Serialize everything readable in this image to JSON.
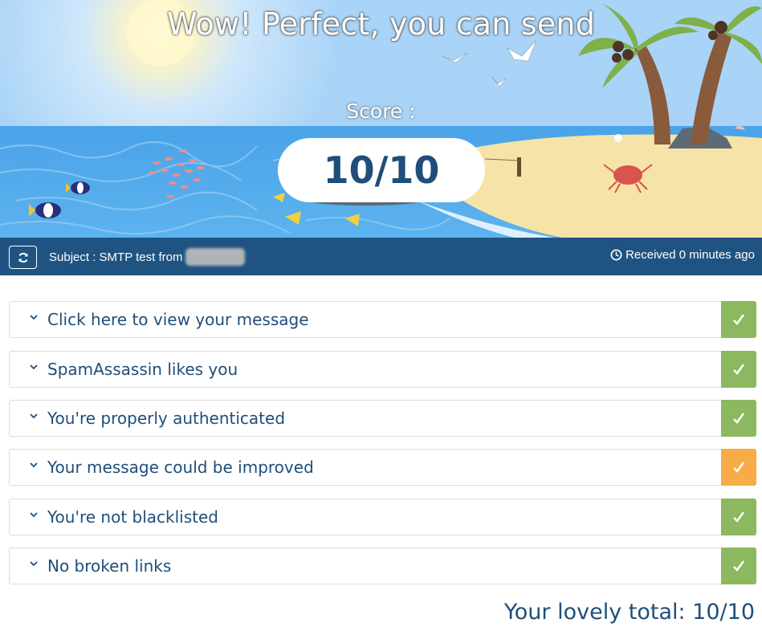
{
  "hero": {
    "title": "Wow! Perfect, you can send",
    "score_label": "Score :",
    "score_value": "10/10"
  },
  "infobar": {
    "refresh_icon": "refresh-icon",
    "subject_text": "Subject : SMTP test from",
    "received_icon": "clock-icon",
    "received_text": "Received 0 minutes ago"
  },
  "checks": [
    {
      "label": "Click here to view your message",
      "status": "ok",
      "icon": "checkmark-icon"
    },
    {
      "label": "SpamAssassin likes you",
      "status": "ok",
      "icon": "checkmark-icon"
    },
    {
      "label": "You're properly authenticated",
      "status": "ok",
      "icon": "checkmark-icon"
    },
    {
      "label": "Your message could be improved",
      "status": "warning",
      "icon": "checkmark-icon"
    },
    {
      "label": "You're not blacklisted",
      "status": "ok",
      "icon": "checkmark-icon"
    },
    {
      "label": "No broken links",
      "status": "ok",
      "icon": "checkmark-icon"
    }
  ],
  "total": "Your lovely total: 10/10",
  "colors": {
    "ok": "#8cb860",
    "warning": "#f7ac47",
    "bar": "#1f5482",
    "text": "#1f4e7a"
  }
}
